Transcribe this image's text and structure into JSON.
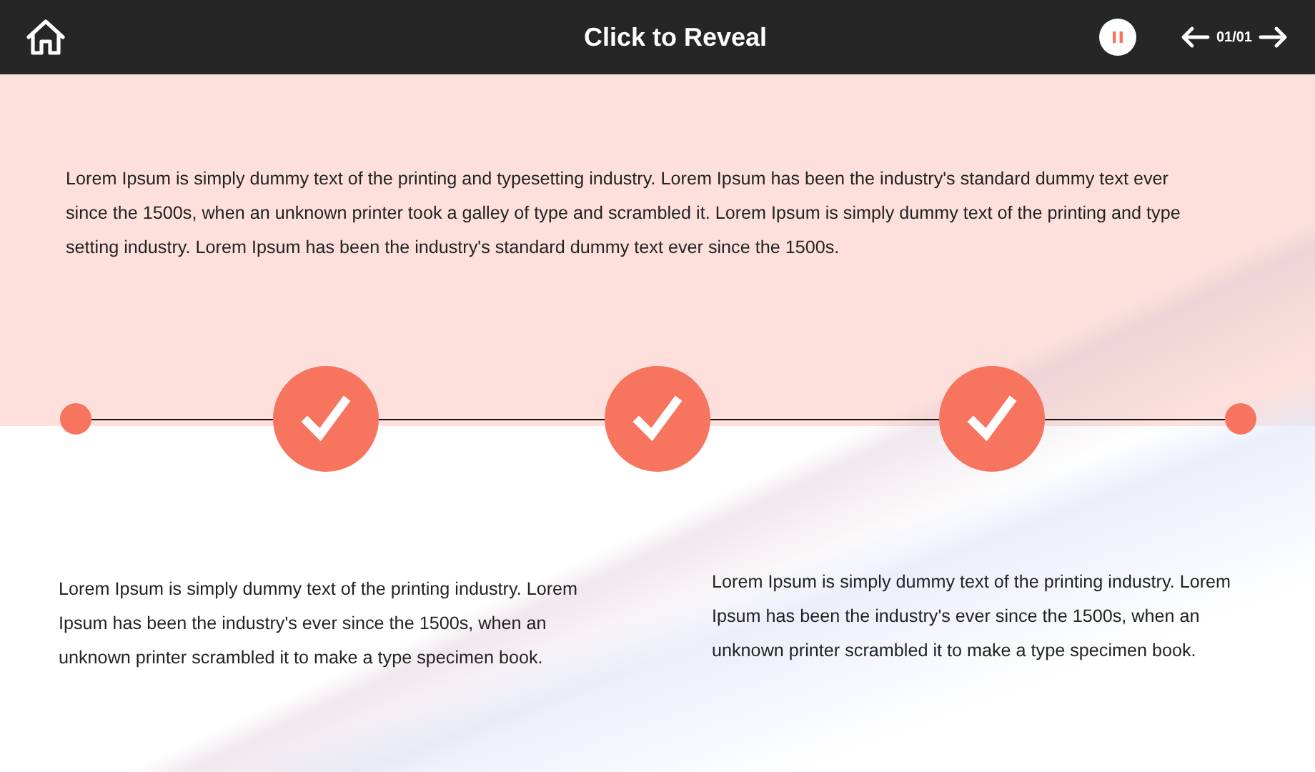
{
  "header": {
    "title": "Click to Reveal",
    "counter": "01/01"
  },
  "intro": "Lorem Ipsum is simply dummy text of the printing and typesetting industry. Lorem Ipsum has been the industry's standard dummy text ever since the 1500s, when an unknown printer took a galley of type and scrambled it. Lorem Ipsum is simply dummy text of the printing and type setting industry. Lorem Ipsum has been the industry's standard dummy text ever since the 1500s.",
  "timeline": [
    {
      "kind": "endpoint"
    },
    {
      "kind": "check"
    },
    {
      "kind": "check"
    },
    {
      "kind": "check"
    },
    {
      "kind": "endpoint"
    }
  ],
  "reveals": [
    "Lorem Ipsum is simply dummy text of the printing industry. Lorem Ipsum has been the industry's ever since the 1500s, when an unknown printer scrambled it to make a type specimen book.",
    "Lorem Ipsum is simply dummy text of the printing industry. Lorem Ipsum has been the industry's ever since the 1500s, when an unknown printer scrambled it to make a type specimen book."
  ]
}
